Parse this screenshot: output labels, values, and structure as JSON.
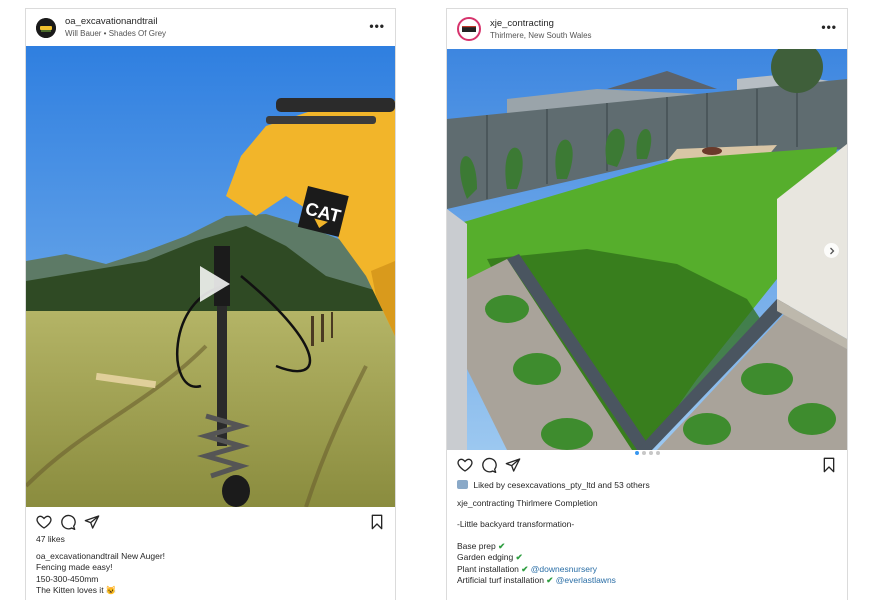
{
  "post1": {
    "username": "oa_excavationandtrail",
    "subtitle": "Will Bauer • Shades Of Grey",
    "more_label": "•••",
    "likes": "47 likes",
    "caption_user": "oa_excavationandtrail",
    "caption_lines": [
      "New Auger!",
      "Fencing made easy!",
      "150-300-450mm",
      "The Kitten loves it 😺"
    ],
    "media_brand": "CAT",
    "colors": {
      "sky": "#3b86e0",
      "grass": "#a7a54e",
      "machine": "#f2b52a"
    }
  },
  "post2": {
    "username": "xje_contracting",
    "subtitle": "Thirlmere, New South Wales",
    "more_label": "•••",
    "liked_by_prefix": "Liked by",
    "liked_by_user": "cesexcavations_pty_ltd",
    "liked_by_and": "and",
    "liked_by_others": "53 others",
    "caption_user": "xje_contracting",
    "caption_title": "Thirlmere Completion",
    "caption_sub": "-Little backyard transformation-",
    "checklist": [
      {
        "text": "Base prep",
        "check": "✔",
        "mention": ""
      },
      {
        "text": "Garden edging",
        "check": "✔",
        "mention": ""
      },
      {
        "text": "Plant installation",
        "check": "✔",
        "mention": "@downesnursery"
      },
      {
        "text": "Artificial turf installation",
        "check": "✔",
        "mention": "@everlastlawns"
      }
    ],
    "colors": {
      "turf": "#4fa82a",
      "fence": "#5e6a6d",
      "sky": "#4e93e0"
    }
  }
}
